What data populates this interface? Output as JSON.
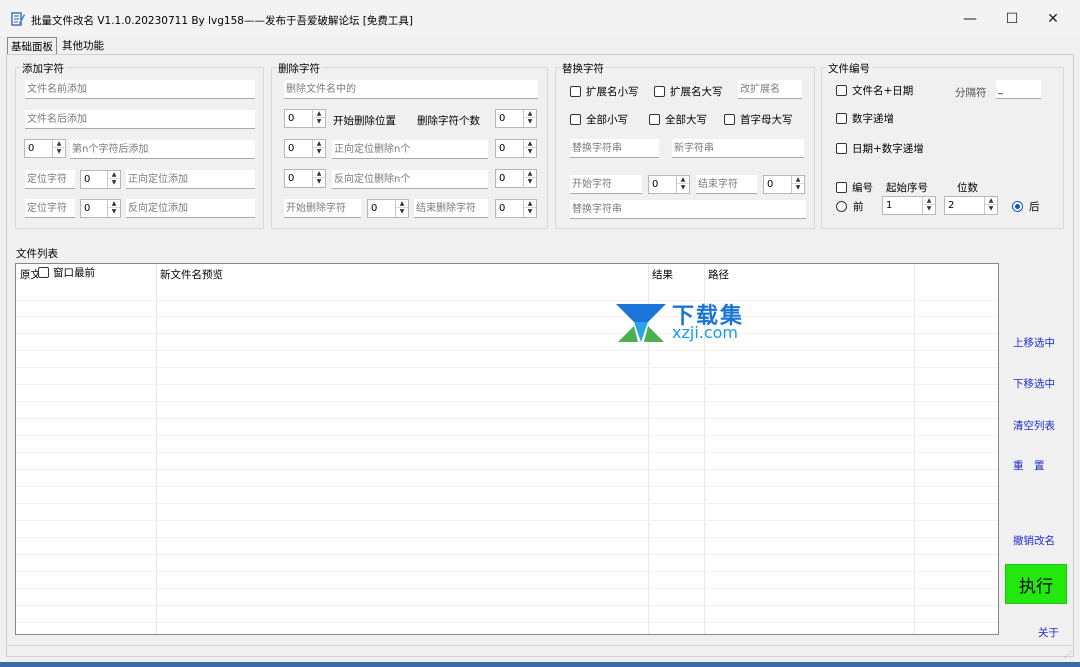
{
  "window": {
    "title": "批量文件改名  V1.1.0.20230711  By lvg158——发布于吾爱破解论坛 [免费工具]",
    "controls": {
      "minimize": "—",
      "maximize": "☐",
      "close": "✕"
    }
  },
  "tabs": [
    {
      "label": "基础面板",
      "active": true
    },
    {
      "label": "其他功能",
      "active": false
    }
  ],
  "add_chars": {
    "title": "添加字符",
    "prefix_placeholder": "文件名前添加",
    "suffix_placeholder": "文件名后添加",
    "nth_value": "0",
    "nth_placeholder": "第n个字符后添加",
    "pos_char_label_1": "定位字符",
    "forward_value": "0",
    "forward_placeholder": "正向定位添加",
    "pos_char_label_2": "定位字符",
    "backward_value": "0",
    "backward_placeholder": "反向定位添加"
  },
  "delete_chars": {
    "title": "删除字符",
    "in_name_placeholder": "删除文件名中的",
    "start_pos_value": "0",
    "start_pos_label": "开始删除位置",
    "count_label": "删除字符个数",
    "count_value": "0",
    "forward_n_value": "0",
    "forward_n_placeholder": "正向定位删除n个",
    "forward_n_count": "0",
    "backward_n_value": "0",
    "backward_n_placeholder": "反向定位删除n个",
    "backward_n_count": "0",
    "start_char_placeholder": "开始删除字符",
    "start_char_value": "0",
    "end_char_placeholder": "结束删除字符",
    "end_char_value": "0"
  },
  "replace_chars": {
    "title": "替换字符",
    "ext_lower": "扩展名小写",
    "ext_upper": "扩展名大写",
    "change_ext_placeholder": "改扩展名",
    "all_lower": "全部小写",
    "all_upper": "全部大写",
    "capitalize": "首字母大写",
    "replace_str_placeholder": "替换字符串",
    "new_str_placeholder": "新字符串",
    "start_char_placeholder": "开始字符",
    "start_value": "0",
    "end_char_placeholder": "结束字符",
    "end_value": "0",
    "replace_str2_placeholder": "替换字符串"
  },
  "numbering": {
    "title": "文件编号",
    "name_date": "文件名+日期",
    "separator_label": "分隔符",
    "separator_value": "_",
    "num_increment": "数字递增",
    "date_num_increment": "日期+数字递增",
    "number_label": "编号",
    "start_seq_label": "起始序号",
    "digits_label": "位数",
    "front_label": "前",
    "start_seq_value": "1",
    "digits_value": "2",
    "back_label": "后",
    "position_selected": "后"
  },
  "file_list": {
    "title": "文件列表",
    "topmost_label": "窗口最前",
    "columns": [
      "原文",
      "新文件名预览",
      "结果",
      "路径"
    ]
  },
  "side_actions": {
    "move_up": "上移选中",
    "move_down": "下移选中",
    "clear": "清空列表",
    "reset": "重　置",
    "undo": "撤销改名",
    "execute": "执行",
    "about": "关于"
  },
  "watermark": {
    "cn": "下载集",
    "en": "xzji.com"
  }
}
